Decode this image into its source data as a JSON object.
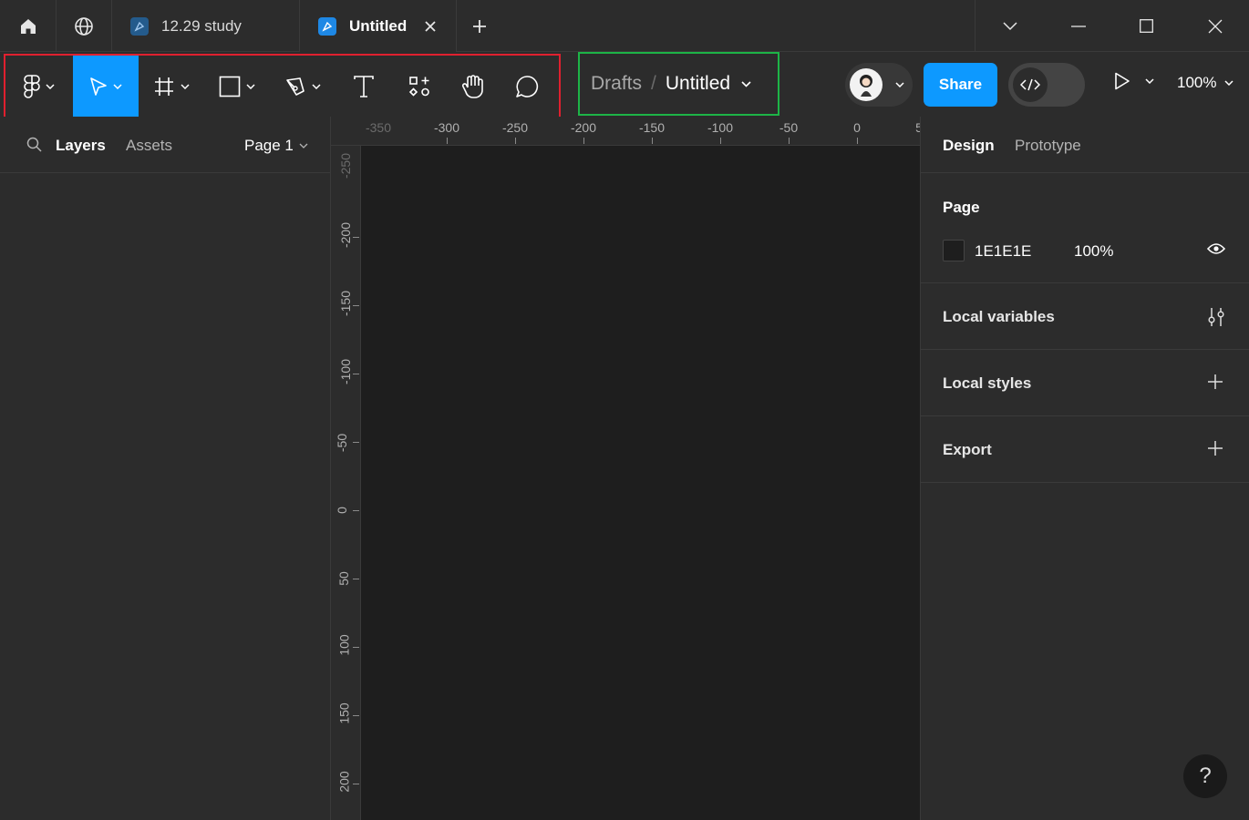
{
  "tabs": [
    {
      "label": "12.29 study",
      "active": false
    },
    {
      "label": "Untitled",
      "active": true
    }
  ],
  "breadcrumb": {
    "parent": "Drafts",
    "separator": "/",
    "file": "Untitled"
  },
  "toolbar": {
    "share_label": "Share",
    "zoom_label": "100%",
    "active_tool": "move",
    "highlight_colors": {
      "tools_box": "#e0202f",
      "breadcrumb_box": "#1db447",
      "accent": "#0d99ff"
    }
  },
  "left_panel": {
    "tab_layers": "Layers",
    "tab_assets": "Assets",
    "page_label": "Page 1"
  },
  "ruler": {
    "top_labels": [
      "-350",
      "-300",
      "-250",
      "-200",
      "-150",
      "-100",
      "-50",
      "0",
      "5"
    ],
    "left_labels": [
      "-250",
      "-200",
      "-150",
      "-100",
      "-50",
      "0",
      "50",
      "100",
      "150",
      "200"
    ]
  },
  "right_panel": {
    "tab_design": "Design",
    "tab_prototype": "Prototype",
    "page_section_title": "Page",
    "page_color_hex": "1E1E1E",
    "page_opacity": "100%",
    "local_variables": "Local variables",
    "local_styles": "Local styles",
    "export": "Export"
  },
  "help_label": "?"
}
